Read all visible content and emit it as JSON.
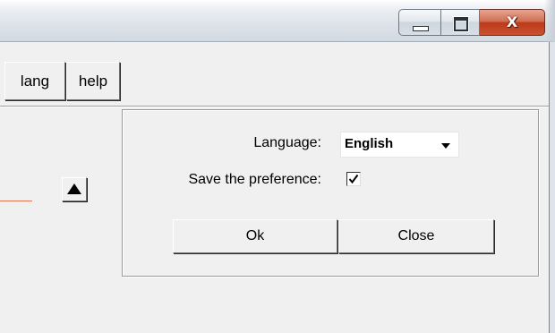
{
  "window": {
    "controls": {
      "minimize_icon": "minimize-icon",
      "maximize_icon": "maximize-icon",
      "close_icon": "close-icon",
      "close_glyph": "X"
    },
    "colors": {
      "close_button": "#c8532f",
      "accent_line": "#e2754f"
    }
  },
  "menu": {
    "items": [
      {
        "label": "lang"
      },
      {
        "label": "help"
      }
    ]
  },
  "side": {
    "up_button_icon": "up-arrow-icon"
  },
  "dialog": {
    "language_label": "Language:",
    "language_value": "English",
    "save_preference_label": "Save the preference:",
    "save_preference_checked": true,
    "ok_label": "Ok",
    "close_label": "Close"
  }
}
